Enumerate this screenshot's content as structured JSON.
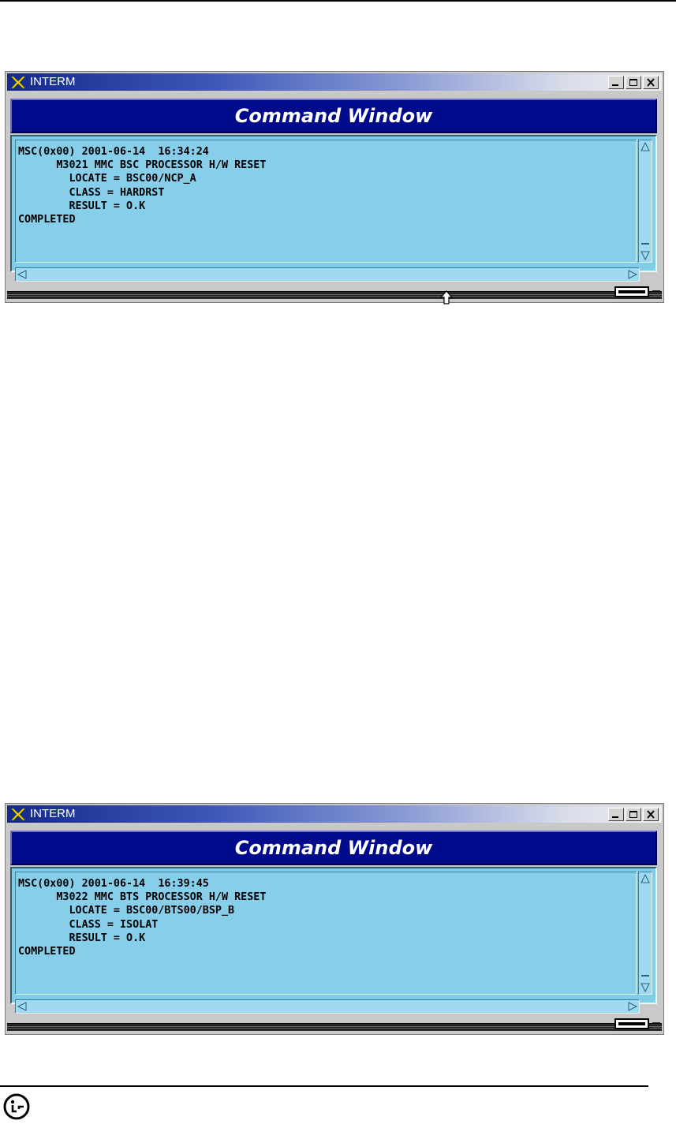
{
  "windows": [
    {
      "app_title": "INTERM",
      "header": "Command Window",
      "output_lines": [
        "MSC(0x00) 2001-06-14  16:34:24",
        "      M3021 MMC BSC PROCESSOR H/W RESET",
        "        LOCATE = BSC00/NCP_A",
        "        CLASS = HARDRST",
        "        RESULT = O.K",
        "COMPLETED"
      ]
    },
    {
      "app_title": "INTERM",
      "header": "Command Window",
      "output_lines": [
        "MSC(0x00) 2001-06-14  16:39:45",
        "      M3022 MMC BTS PROCESSOR H/W RESET",
        "        LOCATE = BSC00/BTS00/BSP_B",
        "        CLASS = ISOLAT",
        "        RESULT = O.K",
        "COMPLETED"
      ]
    }
  ],
  "icons": {
    "app": "x-window-icon",
    "minimize": "minimize-icon",
    "maximize": "maximize-icon",
    "close": "close-icon",
    "scroll_up": "arrow-up-icon",
    "scroll_down": "arrow-down-icon",
    "scroll_left": "arrow-left-icon",
    "scroll_right": "arrow-right-icon",
    "cursor": "cursor-arrow-icon",
    "logo": "lg-logo-icon"
  },
  "colors": {
    "header_bg": "#000b8c",
    "output_bg": "#87ceeb",
    "header_text": "#ffffff"
  }
}
